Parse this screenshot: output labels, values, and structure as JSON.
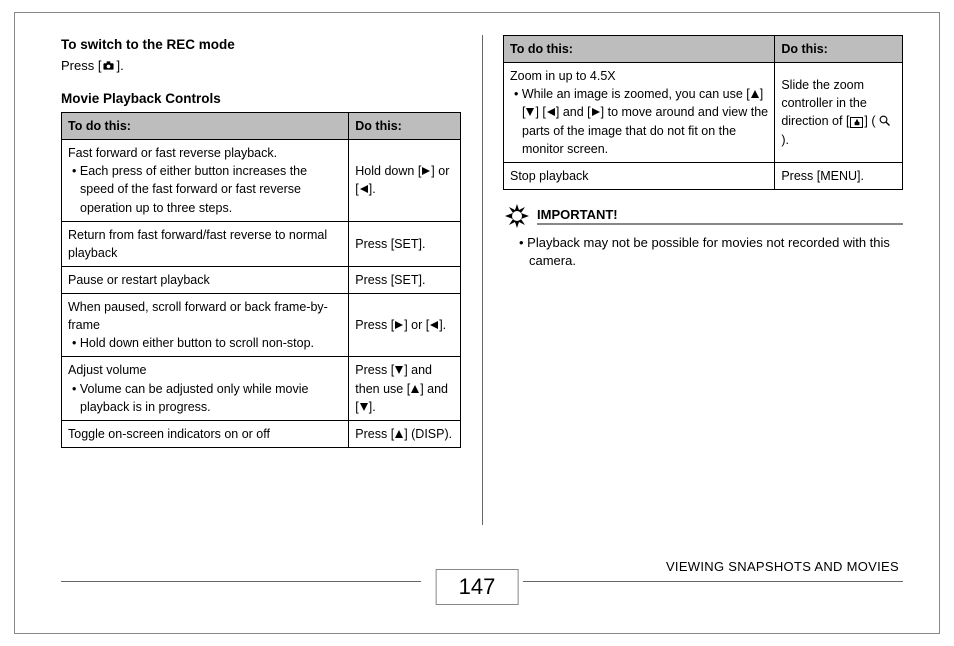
{
  "heading_rec": "To switch to the REC mode",
  "press_prefix": "Press [",
  "press_suffix": "].",
  "heading_controls": "Movie Playback Controls",
  "table_header_left": "To do this:",
  "table_header_right": "Do this:",
  "left_rows": [
    {
      "task": "Fast forward or fast reverse playback.",
      "task_sub": "Each press of either button increases the speed of the fast forward or fast reverse operation up to three steps.",
      "action_pre": "Hold down [",
      "action_mid": "] or [",
      "action_post": "]."
    },
    {
      "task": "Return from fast forward/fast reverse to normal playback",
      "action": "Press [SET]."
    },
    {
      "task": "Pause or restart playback",
      "action": "Press [SET]."
    },
    {
      "task": "When paused, scroll forward or back frame-by-frame",
      "task_sub": "Hold down either button to scroll non-stop.",
      "action_pre": "Press [",
      "action_mid": "] or [",
      "action_post": "]."
    },
    {
      "task": "Adjust volume",
      "task_sub": "Volume can be adjusted only while movie playback is in progress.",
      "action_l1_pre": "Press [",
      "action_l1_post": "] and",
      "action_l2_pre": "then use [",
      "action_l2_mid": "] and [",
      "action_l2_post": "]."
    },
    {
      "task": "Toggle on-screen indicators on or off",
      "action_pre": "Press [",
      "action_post": "] (DISP)."
    }
  ],
  "right_rows": [
    {
      "task": "Zoom in up to 4.5X",
      "task_sub_pre": "While an image is zoomed, you can use [",
      "task_sub_mid1": "] [",
      "task_sub_mid2": "] [",
      "task_sub_mid3": "] and [",
      "task_sub_post": "] to move around and view the parts of the image that do not fit on the monitor screen.",
      "action_l1": "Slide the zoom controller in the direction of [",
      "action_l2_pre": "] ( ",
      "action_l2_post": " )."
    },
    {
      "task": "Stop playback",
      "action": "Press [MENU]."
    }
  ],
  "important_label": "IMPORTANT!",
  "important_note": "Playback may not be possible for movies not recorded with this camera.",
  "page_number": "147",
  "footer_title": "VIEWING SNAPSHOTS AND MOVIES"
}
